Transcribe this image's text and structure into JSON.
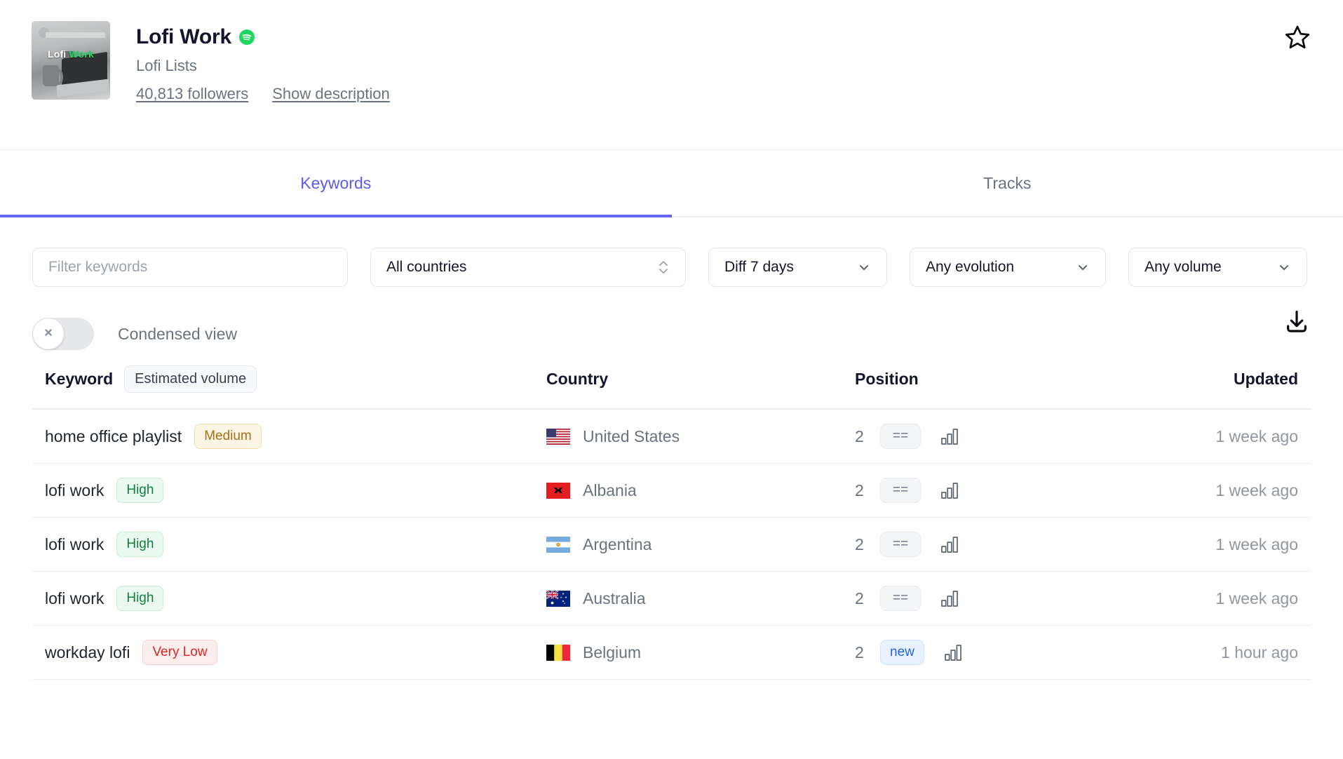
{
  "header": {
    "cover_label_part1": "Lofi",
    "cover_label_part2": "Work",
    "title": "Lofi Work",
    "platform_icon": "spotify-icon",
    "owner": "Lofi Lists",
    "followers": "40,813 followers",
    "show_description": "Show description",
    "favorite_icon": "star-icon"
  },
  "tabs": [
    {
      "label": "Keywords",
      "active": true
    },
    {
      "label": "Tracks",
      "active": false
    }
  ],
  "filters": {
    "keyword_filter_placeholder": "Filter keywords",
    "keyword_filter_value": "",
    "country": "All countries",
    "diff": "Diff 7 days",
    "evolution": "Any evolution",
    "volume": "Any volume"
  },
  "toolbar": {
    "condensed_view_label": "Condensed view",
    "condensed_view_on": false,
    "toggle_knob_icon": "close-icon",
    "download_icon": "download-icon"
  },
  "table": {
    "columns": {
      "keyword": "Keyword",
      "estimated_volume_pill": "Estimated volume",
      "country": "Country",
      "position": "Position",
      "updated": "Updated"
    },
    "rows": [
      {
        "keyword": "home office playlist",
        "volume": "Medium",
        "volume_class": "vol-Medium",
        "country": "United States",
        "flag": "flag-us",
        "position": "2",
        "evolution": "==",
        "evolution_class": "evo-eq",
        "chart_icon": "bar-chart-icon",
        "updated": "1 week ago"
      },
      {
        "keyword": "lofi work",
        "volume": "High",
        "volume_class": "vol-High",
        "country": "Albania",
        "flag": "flag-al",
        "position": "2",
        "evolution": "==",
        "evolution_class": "evo-eq",
        "chart_icon": "bar-chart-icon",
        "updated": "1 week ago"
      },
      {
        "keyword": "lofi work",
        "volume": "High",
        "volume_class": "vol-High",
        "country": "Argentina",
        "flag": "flag-ar",
        "position": "2",
        "evolution": "==",
        "evolution_class": "evo-eq",
        "chart_icon": "bar-chart-icon",
        "updated": "1 week ago"
      },
      {
        "keyword": "lofi work",
        "volume": "High",
        "volume_class": "vol-High",
        "country": "Australia",
        "flag": "flag-au",
        "position": "2",
        "evolution": "==",
        "evolution_class": "evo-eq",
        "chart_icon": "bar-chart-icon",
        "updated": "1 week ago"
      },
      {
        "keyword": "workday lofi",
        "volume": "Very Low",
        "volume_class": "vol-VeryLow",
        "country": "Belgium",
        "flag": "flag-be",
        "position": "2",
        "evolution": "new",
        "evolution_class": "evo-new",
        "chart_icon": "bar-chart-icon",
        "updated": "1 hour ago"
      }
    ]
  },
  "colors": {
    "accent": "#6366f1",
    "spotify_green": "#1fd760",
    "text_dark": "#14142e",
    "text_muted": "#6b7280",
    "badge_new": "#2563eb",
    "badge_high": "#12803c",
    "badge_medium": "#a8701a",
    "badge_verylow": "#e02424"
  }
}
